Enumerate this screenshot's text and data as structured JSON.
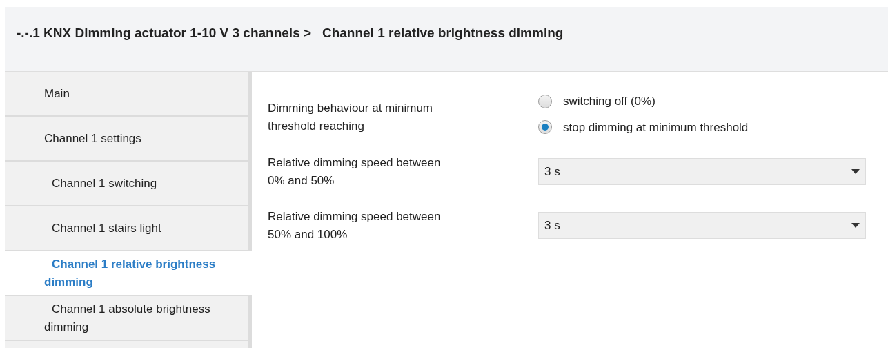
{
  "header": {
    "title": "-.-.1 KNX Dimming actuator 1-10 V 3 channels >   Channel 1 relative brightness dimming"
  },
  "sidebar": {
    "items": [
      {
        "label": "Main",
        "selected": false
      },
      {
        "label": "Channel 1 settings",
        "selected": false,
        "children": [
          {
            "label": "Channel 1 switching",
            "selected": false
          },
          {
            "label": "Channel 1 stairs light",
            "selected": false
          },
          {
            "label": "Channel 1 relative brightness dimming",
            "selected": true
          },
          {
            "label": "Channel 1 absolute brightness dimming",
            "selected": false
          }
        ]
      }
    ]
  },
  "parameters": [
    {
      "kind": "radio",
      "label": "Dimming behaviour at minimum threshold reaching",
      "options": [
        {
          "label": "switching off (0%)",
          "selected": false
        },
        {
          "label": "stop dimming at minimum threshold",
          "selected": true
        }
      ]
    },
    {
      "kind": "dropdown",
      "label": "Relative dimming speed between 0% and 50%",
      "value": "3 s"
    },
    {
      "kind": "dropdown",
      "label": "Relative dimming speed between 50% and 100%",
      "value": "3 s"
    }
  ]
}
